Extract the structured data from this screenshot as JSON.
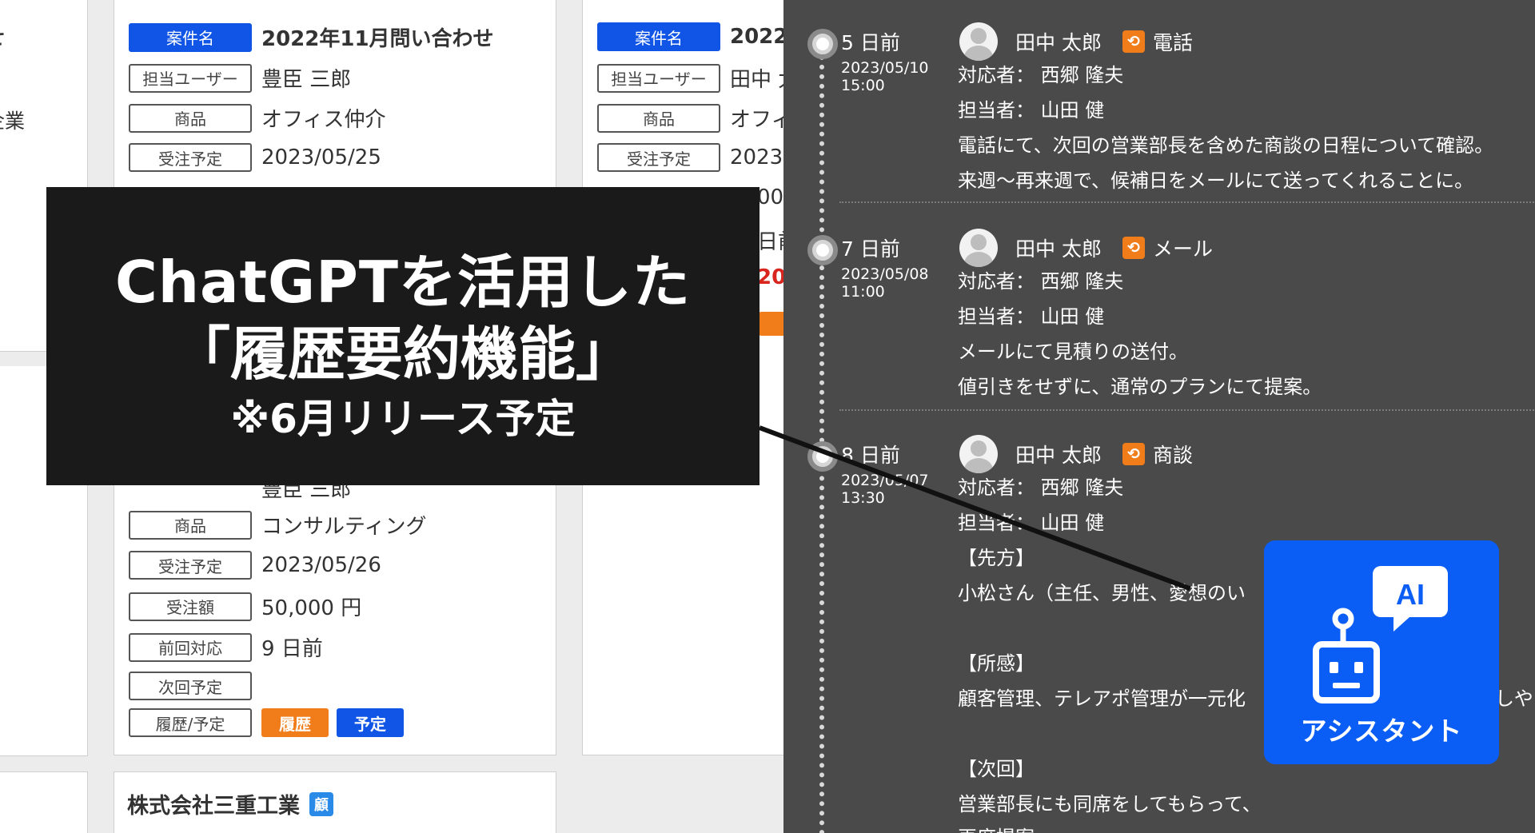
{
  "left_partial": {
    "top_text": "せ",
    "mid_text": "企業"
  },
  "card1": {
    "fields": [
      {
        "label": "案件名",
        "value": "2022年11月問い合わせ"
      },
      {
        "label": "担当ユーザー",
        "value": "豊臣 三郎"
      },
      {
        "label": "商品",
        "value": "オフィス仲介"
      },
      {
        "label": "受注予定",
        "value": "2023/05/25"
      }
    ],
    "lower_partial_value": "豊臣 三郎",
    "lower_fields": [
      {
        "label": "商品",
        "value": "コンサルティング"
      },
      {
        "label": "受注予定",
        "value": "2023/05/26"
      },
      {
        "label": "受注額",
        "value": "50,000 円"
      },
      {
        "label": "前回対応",
        "value": "9 日前"
      },
      {
        "label": "次回予定",
        "value": ""
      },
      {
        "label": "履歴/予定",
        "value": ""
      }
    ],
    "history_button": "履歴",
    "plan_button": "予定"
  },
  "card2": {
    "fields": [
      {
        "label": "案件名",
        "value": "2022"
      },
      {
        "label": "担当ユーザー",
        "value": "田中 太"
      },
      {
        "label": "商品",
        "value": "オフィ"
      },
      {
        "label": "受注予定",
        "value": "2023"
      }
    ],
    "fragments": [
      "00",
      "日前",
      "20"
    ]
  },
  "card3": {
    "company": "株式会社三重工業",
    "badge": "顧"
  },
  "timeline": {
    "entries": [
      {
        "ago": "5 日前",
        "date": "2023/05/10",
        "time": "15:00",
        "user": "田中 太郎",
        "type_icon": "⟲",
        "type": "電話",
        "lines": [
          "対応者： 西郷 隆夫",
          "担当者： 山田 健",
          "電話にて、次回の営業部長を含めた商談の日程について確認。",
          "来週〜再来週で、候補日をメールにて送ってくれることに。"
        ]
      },
      {
        "ago": "7 日前",
        "date": "2023/05/08",
        "time": "11:00",
        "user": "田中 太郎",
        "type_icon": "⟲",
        "type": "メール",
        "lines": [
          "対応者： 西郷 隆夫",
          "担当者： 山田 健",
          "メールにて見積りの送付。",
          "値引きをせずに、通常のプランにて提案。"
        ]
      },
      {
        "ago": "8 日前",
        "date": "2023/05/07",
        "time": "13:30",
        "user": "田中 太郎",
        "type_icon": "⟲",
        "type": "商談",
        "lines": [
          "対応者： 西郷 隆夫",
          "担当者： 山田 健",
          "【先方】",
          "小松さん（主任、男性、愛想のい",
          "",
          "【所感】",
          "顧客管理、テレアポ管理が一元化",
          "",
          "【次回】",
          "営業部長にも同席をしてもらって、",
          "再度提案"
        ],
        "overflow_text": "しやす"
      }
    ]
  },
  "callout": {
    "line1": "ChatGPTを活用した",
    "line2": "「履歴要約機能」",
    "line3": "※6月リリース予定"
  },
  "assistant": {
    "label": "アシスタント",
    "bubble_text": "AI"
  },
  "colors": {
    "primary_blue": "#1055e6",
    "accent_orange": "#f07c1a",
    "timeline_bg": "#4a4a4a",
    "callout_bg": "#1a1a1a",
    "assistant_blue": "#0b5ef5"
  }
}
